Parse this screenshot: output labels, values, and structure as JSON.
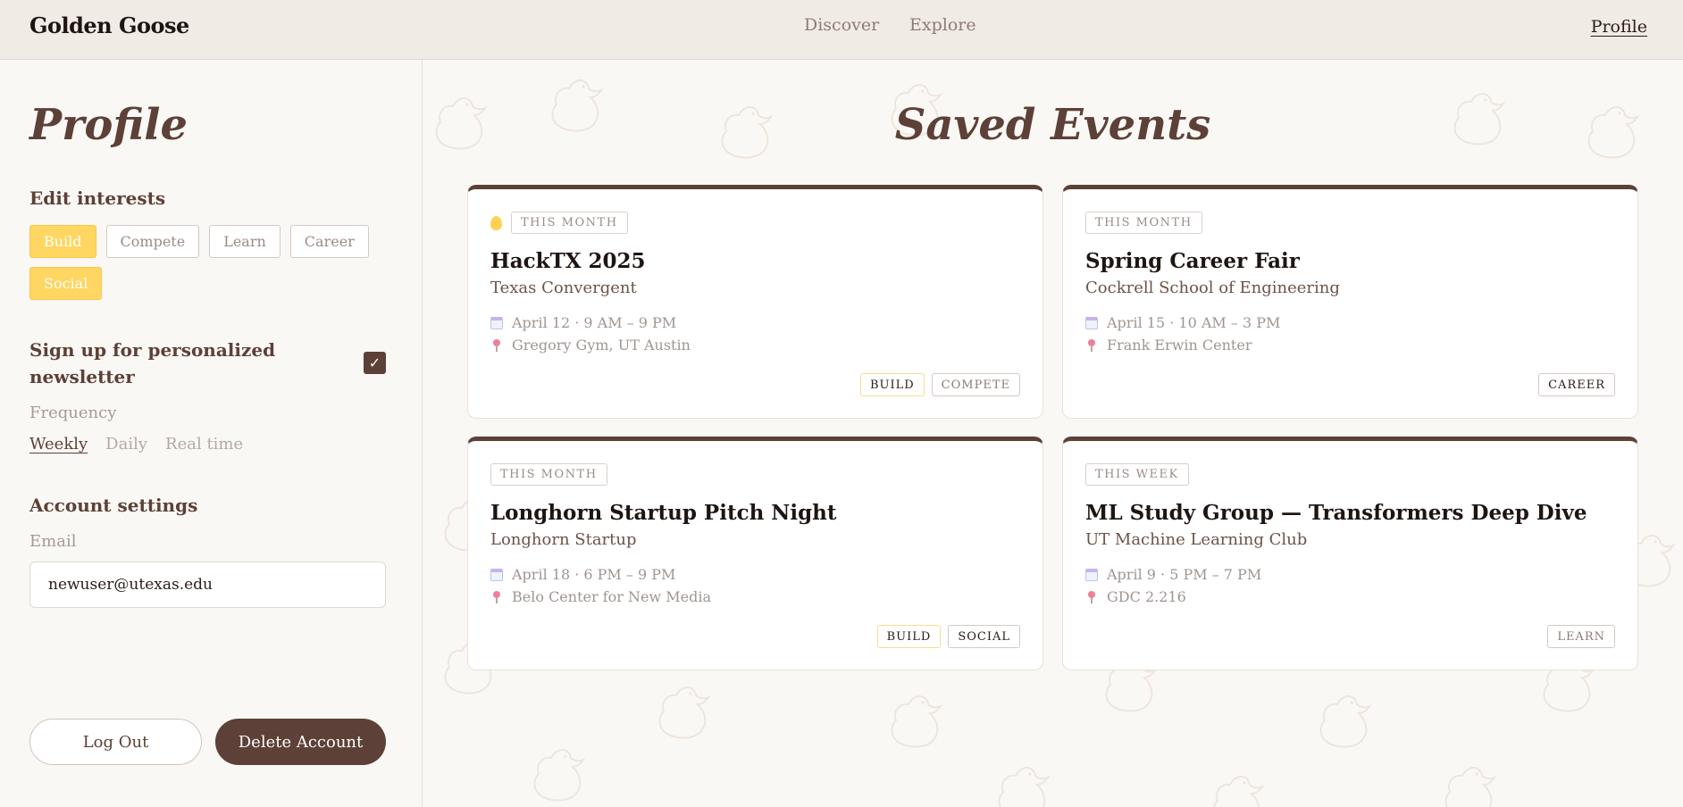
{
  "header": {
    "brand": "Golden Goose",
    "nav": [
      "Discover",
      "Explore"
    ],
    "profile_link": "Profile"
  },
  "sidebar": {
    "title": "Profile",
    "interests_heading": "Edit interests",
    "interests": [
      {
        "label": "Build",
        "selected": true
      },
      {
        "label": "Compete",
        "selected": false
      },
      {
        "label": "Learn",
        "selected": false
      },
      {
        "label": "Career",
        "selected": false
      },
      {
        "label": "Social",
        "selected": true
      }
    ],
    "newsletter_label": "Sign up for personalized newsletter",
    "newsletter_checked": true,
    "check_glyph": "✓",
    "frequency_label": "Frequency",
    "frequency_options": [
      "Weekly",
      "Daily",
      "Real time"
    ],
    "frequency_selected": "Weekly",
    "account_heading": "Account settings",
    "email_label": "Email",
    "email_value": "newuser@utexas.edu",
    "logout_label": "Log Out",
    "delete_label": "Delete Account"
  },
  "main": {
    "title": "Saved Events",
    "events": [
      {
        "badge": "THIS MONTH",
        "title": "HackTX 2025",
        "org": "Texas Convergent",
        "date": "April 12 · 9 AM – 9 PM",
        "location": "Gregory Gym, UT Austin",
        "tags": [
          "BUILD",
          "COMPETE"
        ],
        "has_egg_icon": true
      },
      {
        "badge": "THIS MONTH",
        "title": "Spring Career Fair",
        "org": "Cockrell School of Engineering",
        "date": "April 15 · 10 AM – 3 PM",
        "location": "Frank Erwin Center",
        "tags": [
          "CAREER"
        ],
        "has_egg_icon": false
      },
      {
        "badge": "THIS MONTH",
        "title": "Longhorn Startup Pitch Night",
        "org": "Longhorn Startup",
        "date": "April 18 · 6 PM – 9 PM",
        "location": "Belo Center for New Media",
        "tags": [
          "BUILD",
          "SOCIAL"
        ],
        "has_egg_icon": false
      },
      {
        "badge": "THIS WEEK",
        "title": "ML Study Group — Transformers Deep Dive",
        "org": "UT Machine Learning Club",
        "date": "April 9 · 5 PM – 7 PM",
        "location": "GDC 2.216",
        "tags": [
          "LEARN"
        ],
        "has_egg_icon": false
      }
    ]
  },
  "colors": {
    "accent": "#5d4037",
    "chip_selected": "#fed661",
    "header_bg": "#f1ebe5",
    "page_bg": "#faf8f5"
  }
}
